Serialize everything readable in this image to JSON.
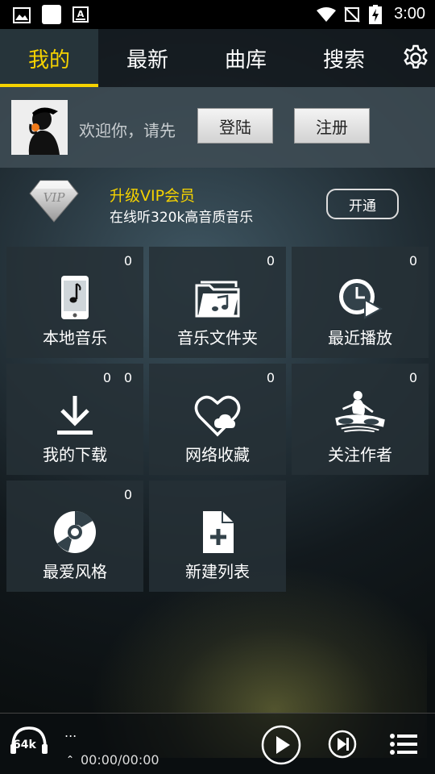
{
  "status_bar": {
    "time": "3:00"
  },
  "tabs": [
    {
      "label": "我的",
      "active": true
    },
    {
      "label": "最新",
      "active": false
    },
    {
      "label": "曲库",
      "active": false
    },
    {
      "label": "搜索",
      "active": false
    }
  ],
  "login": {
    "welcome": "欢迎你，请先",
    "login_label": "登陆",
    "register_label": "注册"
  },
  "vip": {
    "badge_text": "VIP",
    "title": "升级VIP会员",
    "subtitle": "在线听320k高音质音乐",
    "button": "开通"
  },
  "tiles": [
    {
      "label": "本地音乐",
      "count": "0",
      "icon": "phone-music-icon"
    },
    {
      "label": "音乐文件夹",
      "count": "0",
      "icon": "music-folder-icon"
    },
    {
      "label": "最近播放",
      "count": "0",
      "icon": "recent-play-icon"
    },
    {
      "label": "我的下载",
      "count": "0",
      "count2": "0",
      "icon": "download-icon"
    },
    {
      "label": "网络收藏",
      "count": "0",
      "icon": "heart-cloud-icon"
    },
    {
      "label": "关注作者",
      "count": "0",
      "icon": "dj-artist-icon"
    },
    {
      "label": "最爱风格",
      "count": "0",
      "icon": "disc-icon"
    },
    {
      "label": "新建列表",
      "icon": "new-file-icon"
    }
  ],
  "player": {
    "quality": "64k",
    "song": "...",
    "time": "00:00/00:00"
  },
  "colors": {
    "accent": "#f5d200"
  }
}
